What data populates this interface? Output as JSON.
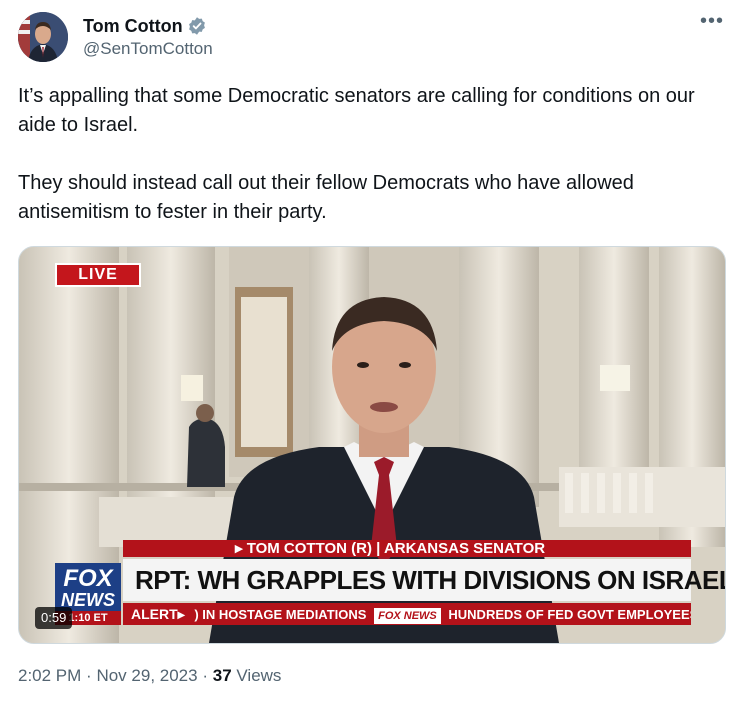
{
  "author": {
    "display_name": "Tom Cotton",
    "handle": "@SenTomCotton",
    "verified_icon": "verified-badge-icon",
    "verified_color": "#829aab"
  },
  "more_icon": "more-horizontal-icon",
  "tweet": {
    "paragraphs": [
      "It’s appalling that some Democratic senators are calling for conditions on our aide to Israel.",
      "They should instead call out their fellow Democrats who have allowed antisemitism to fester in their party."
    ]
  },
  "video": {
    "live_badge": "LIVE",
    "chyron_top": "▸ TOM COTTON (R) | ARKANSAS SENATOR",
    "chyron_main": "RPT: WH GRAPPLES WITH DIVISIONS ON ISRAEL POLICY",
    "alert_label": "ALERT▸",
    "ticker_left": ") IN HOSTAGE MEDIATIONS",
    "ticker_brand": "FOX NEWS",
    "ticker_right": "HUNDREDS OF FED GOVT EMPLOYEES",
    "logo_fox": "FOX",
    "logo_news": "NEWS",
    "logo_time": "1:10 ET",
    "duration": "0:59"
  },
  "meta": {
    "time": "2:02 PM",
    "separator": "·",
    "date": "Nov 29, 2023",
    "views_count": "37",
    "views_label": "Views"
  }
}
